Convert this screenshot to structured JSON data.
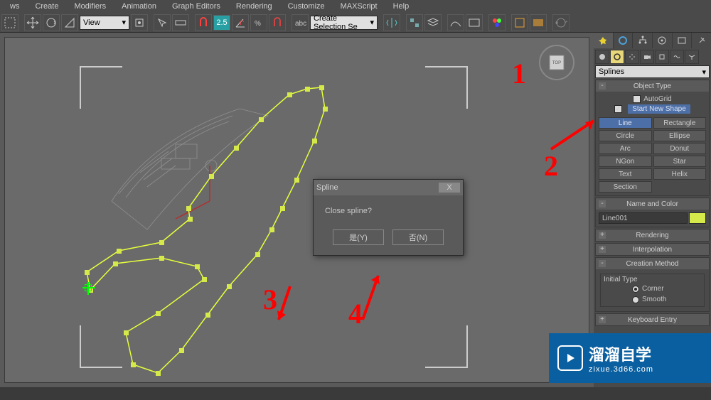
{
  "menu": [
    "ws",
    "Create",
    "Modifiers",
    "Animation",
    "Graph Editors",
    "Rendering",
    "Customize",
    "MAXScript",
    "Help"
  ],
  "toolbar": {
    "view_label": "View",
    "selection_set": "Create Selection Se",
    "snap_value": "2.5"
  },
  "viewcube": {
    "face": "TOP"
  },
  "dialog": {
    "title": "Spline",
    "message": "Close spline?",
    "yes": "是(Y)",
    "no": "否(N)",
    "close": "X"
  },
  "panel": {
    "category": "Splines",
    "rollouts": {
      "object_type": "Object Type",
      "name_color": "Name and Color",
      "rendering": "Rendering",
      "interpolation": "Interpolation",
      "creation_method": "Creation Method",
      "keyboard_entry": "Keyboard Entry"
    },
    "autogrid": "AutoGrid",
    "start_new_shape": "Start New Shape",
    "buttons": [
      [
        "Line",
        "Rectangle"
      ],
      [
        "Circle",
        "Ellipse"
      ],
      [
        "Arc",
        "Donut"
      ],
      [
        "NGon",
        "Star"
      ],
      [
        "Text",
        "Helix"
      ],
      [
        "Section",
        ""
      ]
    ],
    "object_name": "Line001",
    "initial_type": "Initial Type",
    "radio_corner": "Corner",
    "radio_smooth": "Smooth"
  },
  "annotations": {
    "a1": "1",
    "a2": "2",
    "a3": "3",
    "a4": "4"
  },
  "watermark": {
    "text_main": "溜溜自学",
    "text_sub": "zixue.3d66.com"
  }
}
